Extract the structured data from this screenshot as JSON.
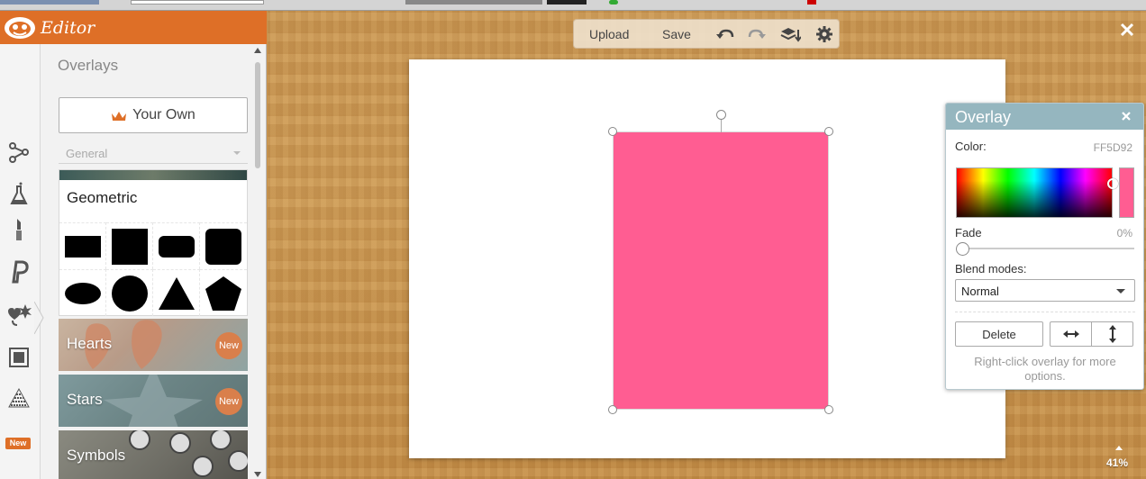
{
  "sidebar": {
    "app_title": "Editor",
    "section_title": "Overlays",
    "your_own_label": "Your Own",
    "category_select": "General",
    "geometric_title": "Geometric",
    "rail_new_badge": "New",
    "categories": [
      {
        "label": "Hearts",
        "badge": "New"
      },
      {
        "label": "Stars",
        "badge": "New"
      },
      {
        "label": "Symbols",
        "badge": ""
      }
    ],
    "rail_icons": [
      "overlays-effects-icon",
      "flask-icon",
      "lipstick-icon",
      "text-p-icon",
      "overlays-shapes-icon",
      "frame-icon",
      "textures-icon"
    ],
    "geo_shapes": [
      "rectangle-wide",
      "square",
      "rounded-rectangle",
      "rounded-square",
      "ellipse",
      "circle",
      "triangle",
      "pentagon"
    ]
  },
  "toolbar": {
    "upload_label": "Upload",
    "save_label": "Save"
  },
  "canvas": {
    "overlay_color": "#FF5D92",
    "zoom_level": "41%"
  },
  "overlay_panel": {
    "title": "Overlay",
    "color_label": "Color:",
    "color_value": "FF5D92",
    "fade_label": "Fade",
    "fade_value": "0%",
    "fade_fraction": 0,
    "blend_label": "Blend modes:",
    "blend_value": "Normal",
    "delete_label": "Delete",
    "hint": "Right-click overlay for more options."
  },
  "colors": {
    "header_orange": "#DE6F27",
    "panel_header": "#95B6BF",
    "overlay_pink": "#FF5D92"
  }
}
